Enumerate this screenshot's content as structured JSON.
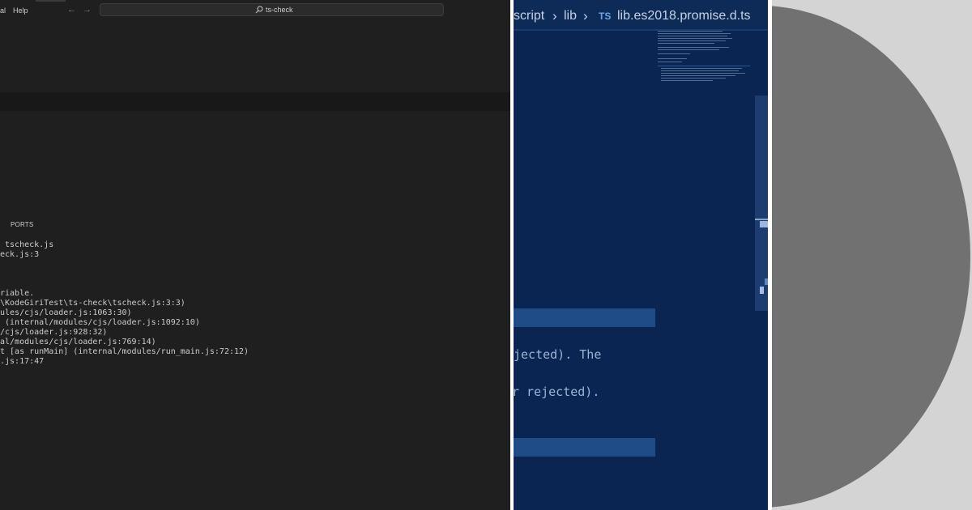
{
  "left_panel": {
    "menu": [
      "al",
      "Help"
    ],
    "command_center": {
      "text": "ts-check"
    },
    "panel_tab": "PORTS",
    "terminal_lines": [
      " tscheck.js",
      "eck.js:3",
      "riable.",
      "\\KodeGiriTest\\ts-check\\tscheck.js:3:3)",
      "ules/cjs/loader.js:1063:30)",
      " (internal/modules/cjs/loader.js:1092:10)",
      "/cjs/loader.js:928:32)",
      "al/modules/cjs/loader.js:769:14)",
      "t [as runMain] (internal/modules/run_main.js:72:12)",
      ".js:17:47"
    ]
  },
  "middle_panel": {
    "breadcrumb": {
      "segment_1": "script",
      "segment_2": "lib",
      "file_icon": "TS",
      "file": "lib.es2018.promise.d.ts"
    },
    "code_lines": [
      "jected). The",
      "r rejected)."
    ]
  },
  "colors": {
    "left_bg": "#1f1f1f",
    "editor_bg": "#0a2551",
    "highlight": "#1f4c86",
    "circle": "#717171"
  }
}
